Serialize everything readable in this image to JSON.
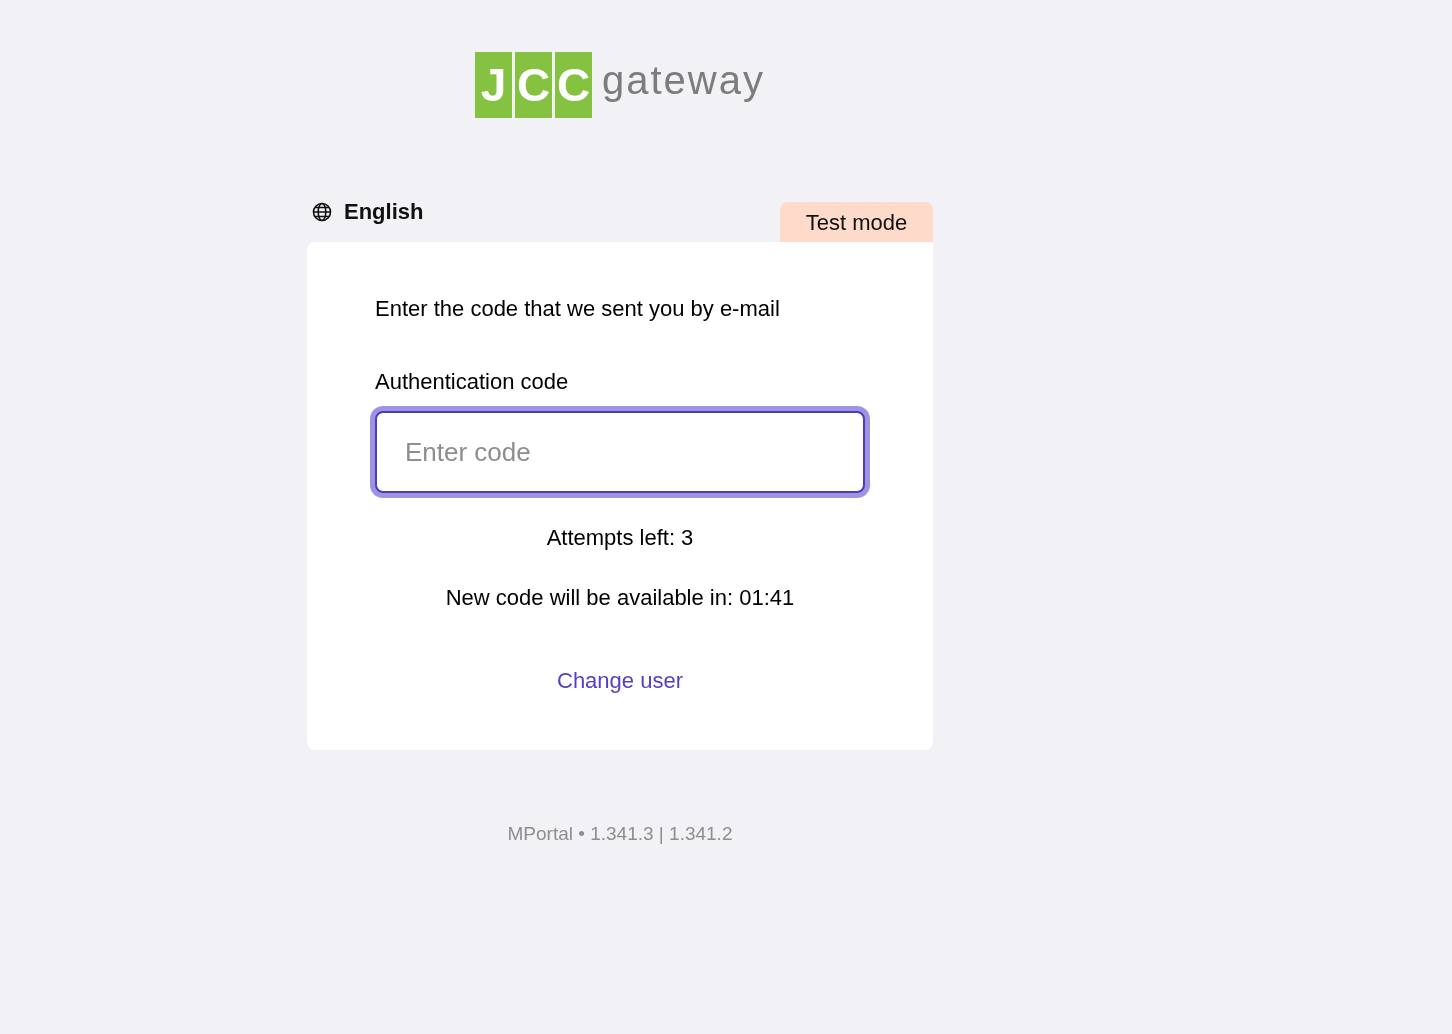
{
  "logo": {
    "letters": [
      "J",
      "C",
      "C"
    ],
    "word": "gateway"
  },
  "language": {
    "label": "English"
  },
  "badge": {
    "label": "Test mode"
  },
  "card": {
    "instruction": "Enter the code that we sent you by e-mail",
    "field": {
      "label": "Authentication code",
      "placeholder": "Enter code",
      "focused": true
    },
    "attempts": "Attempts left: 3",
    "countdown": "New code will be available in: 01:41",
    "link": "Change user"
  },
  "footer": "MPortal • 1.341.3 | 1.341.2"
}
